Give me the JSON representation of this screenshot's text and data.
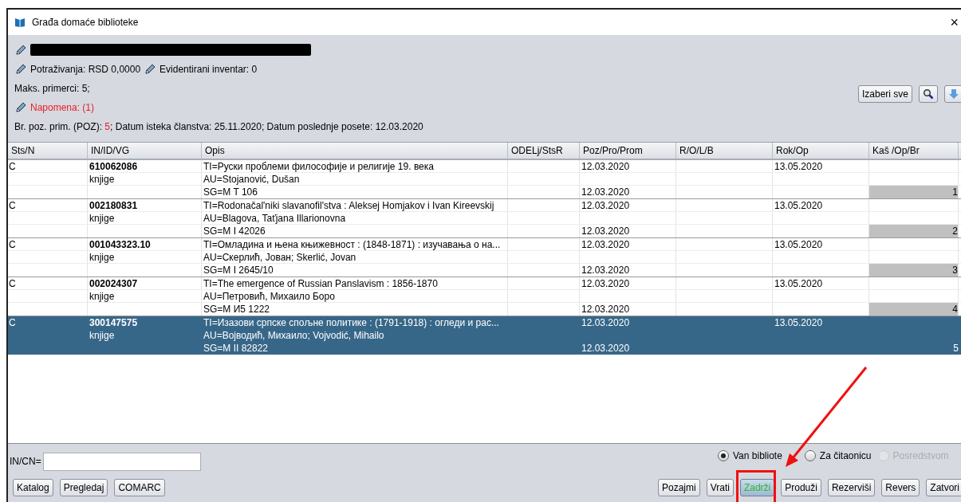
{
  "window": {
    "title": "Građa domaće biblioteke",
    "close": "×"
  },
  "patron": {
    "name_redacted": true,
    "claims": "Potraživanja: RSD 0,0000",
    "inventory": "Evidentirani inventar: 0",
    "max_copies": "Maks. primerci: 5;",
    "note": "Napomena: (1)",
    "info": {
      "label": "Br. poz. prim. (POZ): ",
      "value": "5",
      "rest": "; Datum isteka članstva: 25.11.2020; Datum poslednje posete: 12.03.2020"
    }
  },
  "toolbar": {
    "select_all": "Izaberi sve"
  },
  "table": {
    "columns": [
      "Sts/N",
      "IN/ID/VG",
      "Opis",
      "ODELj/StsR",
      "Poz/Pro/Prom",
      "R/O/L/B",
      "Rok/Op",
      "Kaš /Op/Br"
    ],
    "rows": [
      {
        "sts": "C",
        "id": "610062086",
        "type": "knjige",
        "ti": "TI=Руски проблеми философије и религије 19. века",
        "au": "AU=Stojanović, Dušan",
        "sg": "SG=M T 106",
        "poz": "12.03.2020",
        "rok": "13.05.2020",
        "poz2": "12.03.2020",
        "nr": "1",
        "selected": false
      },
      {
        "sts": "C",
        "id": "002180831",
        "type": "knjige",
        "ti": "TI=Rodonačal'niki slavanofil'stva : Aleksej Homjakov i Ivan Kireevskij",
        "au": "AU=Blagova, Taťjana Illarionovna",
        "sg": "SG=M I 42026",
        "poz": "12.03.2020",
        "rok": "13.05.2020",
        "poz2": "12.03.2020",
        "nr": "2",
        "selected": false
      },
      {
        "sts": "C",
        "id": "001043323.10",
        "type": "knjige",
        "ti": "TI=Омладина и њена књижевност : (1848-1871) : изучавања о на...",
        "au": "AU=Скерлић, Јован; Skerlić, Jovan",
        "sg": "SG=M I 2645/10",
        "poz": "12.03.2020",
        "rok": "13.05.2020",
        "poz2": "12.03.2020",
        "nr": "3",
        "selected": false
      },
      {
        "sts": "C",
        "id": "002024307",
        "type": "knjige",
        "ti": "TI=The emergence of Russian Panslavism : 1856-1870",
        "au": "AU=Петровић, Михаило Боро",
        "sg": "SG=M И5 1222",
        "poz": "12.03.2020",
        "rok": "13.05.2020",
        "poz2": "12.03.2020",
        "nr": "4",
        "selected": false
      },
      {
        "sts": "C",
        "id": "300147575",
        "type": "knjige",
        "ti": "TI=Изазови српске спољне политике : (1791-1918) : огледи и рас...",
        "au": "AU=Војводић, Михаило; Vojvodić, Mihailo",
        "sg": "SG=M II 82822",
        "poz": "12.03.2020",
        "rok": "13.05.2020",
        "poz2": "12.03.2020",
        "nr": "5",
        "selected": true
      }
    ]
  },
  "search": {
    "label": "IN/CN="
  },
  "location": [
    {
      "label": "Van bibliote",
      "selected": true,
      "disabled": false
    },
    {
      "label": "Za čitaonicu",
      "selected": false,
      "disabled": false
    },
    {
      "label": "Posredstvom",
      "selected": false,
      "disabled": true
    }
  ],
  "left_buttons": [
    "Katalog",
    "Pregledaj",
    "COMARC"
  ],
  "right_buttons": [
    {
      "label": "Pozajmi",
      "focused": false
    },
    {
      "label": "Vrati",
      "focused": false
    },
    {
      "label": "Zadrži",
      "focused": true
    },
    {
      "label": "Produži",
      "focused": false
    },
    {
      "label": "Rezerviši",
      "focused": false
    },
    {
      "label": "Revers",
      "focused": false
    },
    {
      "label": "Zatvori",
      "focused": false
    }
  ],
  "annotation": {
    "arrow": true,
    "highlight_box": true
  }
}
